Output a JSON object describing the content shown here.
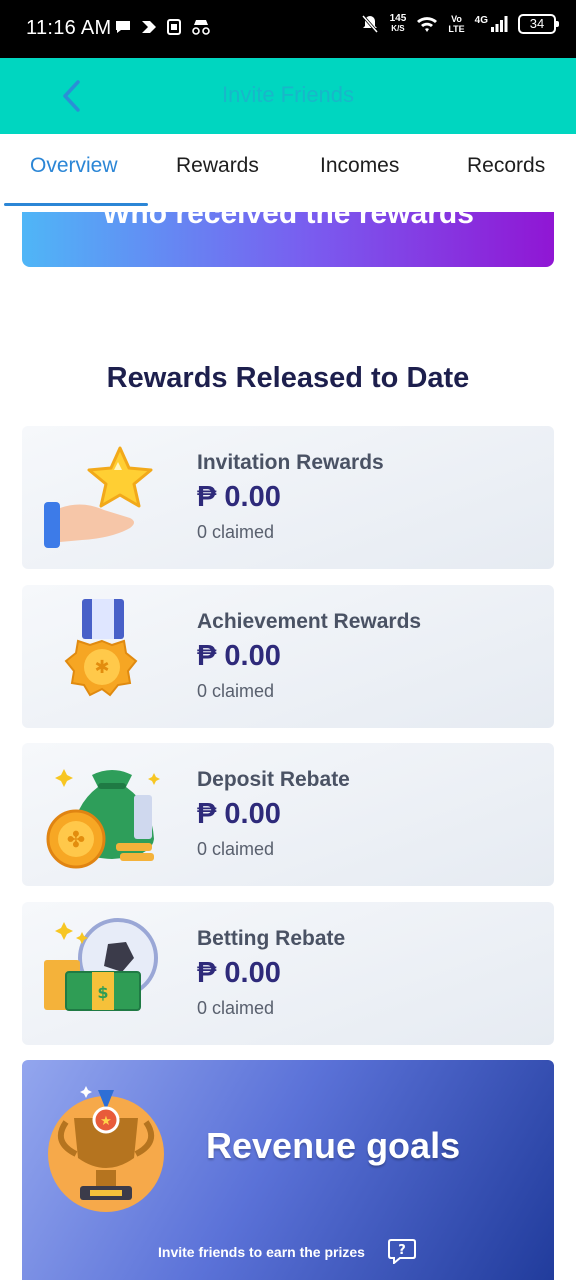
{
  "status_bar": {
    "time": "11:16 AM",
    "net_speed_value": "145",
    "net_speed_unit": "K/S",
    "volte_top": "Vo",
    "volte_bottom": "LTE",
    "network": "4G",
    "battery": "34"
  },
  "header": {
    "title": "Invite Friends"
  },
  "tabs": [
    {
      "label": "Overview",
      "active": true
    },
    {
      "label": "Rewards",
      "active": false
    },
    {
      "label": "Incomes",
      "active": false
    },
    {
      "label": "Records",
      "active": false
    }
  ],
  "banner": {
    "text": "Who received the rewards"
  },
  "section": {
    "title": "Rewards Released to Date"
  },
  "rewards": [
    {
      "name": "Invitation Rewards",
      "amount": "₱ 0.00",
      "claimed": "0 claimed",
      "icon": "hand-star-icon"
    },
    {
      "name": "Achievement Rewards",
      "amount": "₱ 0.00",
      "claimed": "0 claimed",
      "icon": "medal-icon"
    },
    {
      "name": "Deposit Rebate",
      "amount": "₱ 0.00",
      "claimed": "0 claimed",
      "icon": "money-bag-icon"
    },
    {
      "name": "Betting Rebate",
      "amount": "₱ 0.00",
      "claimed": "0 claimed",
      "icon": "ball-cash-icon"
    }
  ],
  "revenue": {
    "title": "Revenue goals",
    "subtitle": "Invite friends to earn the prizes",
    "help_glyph": "?"
  },
  "colors": {
    "header_bg": "#00d6c0",
    "active_tab": "#2b86d6",
    "amount_text": "#2e2a7a"
  }
}
